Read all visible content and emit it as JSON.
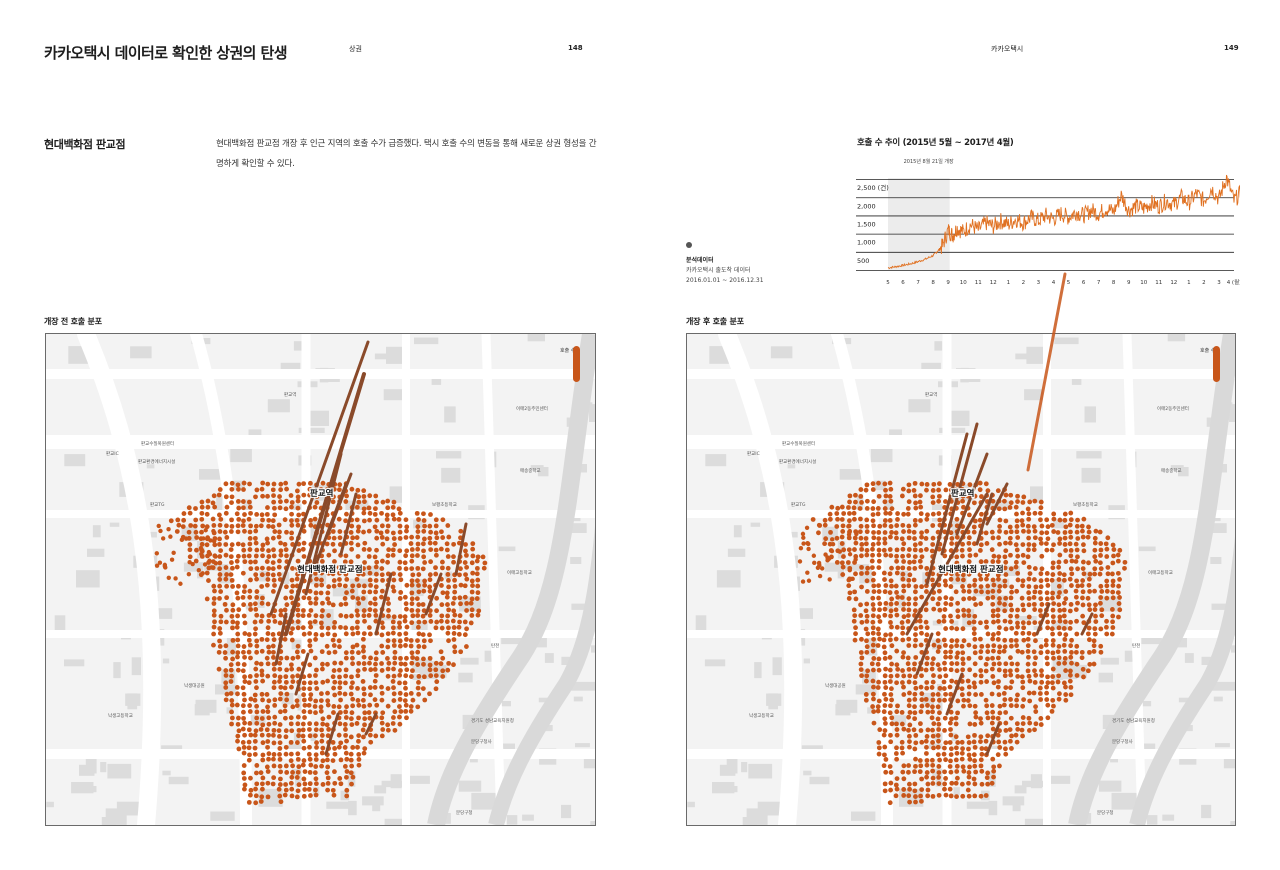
{
  "header": {
    "title": "카카오택시 데이터로 확인한 상권의 탄생",
    "left_section": "상권",
    "left_page": "148",
    "right_section": "카카오택시",
    "right_page": "149"
  },
  "section": {
    "title": "현대백화점 판교점",
    "intro": "현대백화점 판교점 개장 후 인근 지역의 호출 수가 급증했다. 택시 호출 수의 변동을 통해 새로운 상권 형성을 간명하게 확인할 수 있다."
  },
  "note": {
    "label": "분석데이터",
    "line1": "카카오택시 출도착 데이터",
    "line2": "2016.01.01 ~ 2016.12.31"
  },
  "maps": {
    "before_caption": "개장 전 호출 분포",
    "after_caption": "개장 후 호출 분포",
    "legend_label": "호출 수",
    "accent_color": "#c8561a",
    "labels": [
      {
        "text": "판교역",
        "bold": true
      },
      {
        "text": "현대백화점 판교점",
        "bold": true
      },
      {
        "text": "판교IC",
        "bold": false
      },
      {
        "text": "판교수질복원센터",
        "bold": false
      },
      {
        "text": "판교환경에너지시설",
        "bold": false
      },
      {
        "text": "판교TG",
        "bold": false
      },
      {
        "text": "판교역",
        "bold": false
      },
      {
        "text": "이매2동주민센터",
        "bold": false
      },
      {
        "text": "매송중학교",
        "bold": false
      },
      {
        "text": "보평초등학교",
        "bold": false
      },
      {
        "text": "이매고등학교",
        "bold": false
      },
      {
        "text": "탄천",
        "bold": false
      },
      {
        "text": "낙생대공원",
        "bold": false
      },
      {
        "text": "낙생고등학교",
        "bold": false
      },
      {
        "text": "경기도 성남교육지원청",
        "bold": false
      },
      {
        "text": "분당구청사",
        "bold": false
      },
      {
        "text": "분당구청",
        "bold": false
      }
    ]
  },
  "chart_data": {
    "type": "line",
    "title": "호출 수 추이 (2015년 5월 ~ 2017년 4월)",
    "annotation": "2015년 8월 21일 개장",
    "y_tick_labels": [
      "2,500 (건)",
      "2,000",
      "1,500",
      "1,000",
      "500"
    ],
    "y_ticks": [
      2500,
      2000,
      1500,
      1000,
      500
    ],
    "ylim": [
      0,
      2750
    ],
    "x_tick_labels": [
      "5",
      "6",
      "7",
      "8",
      "9",
      "10",
      "11",
      "12",
      "1",
      "2",
      "3",
      "4",
      "5",
      "6",
      "7",
      "8",
      "9",
      "10",
      "11",
      "12",
      "1",
      "2",
      "3",
      "4 (월)"
    ],
    "series": [
      {
        "color": "#e07020",
        "x_months": [
          0,
          0.5,
          1,
          1.5,
          2,
          2.5,
          3,
          3.3,
          3.6,
          4,
          4.3,
          4.6,
          5,
          5.5,
          6,
          6.5,
          7,
          7.5,
          8,
          8.5,
          9,
          9.5,
          10,
          10.5,
          11,
          11.5,
          12,
          12.5,
          13,
          13.5,
          14,
          14.5,
          15,
          15.5,
          16,
          16.5,
          17,
          17.5,
          18,
          18.5,
          19,
          19.5,
          20,
          20.5,
          21,
          21.5,
          22,
          22.5,
          23,
          23.5,
          24
        ],
        "values": [
          60,
          90,
          130,
          170,
          230,
          300,
          400,
          520,
          650,
          1100,
          950,
          1150,
          1050,
          1250,
          1100,
          1300,
          1200,
          1350,
          1250,
          1400,
          1300,
          1450,
          1350,
          1500,
          1400,
          1550,
          1450,
          1600,
          1500,
          1650,
          1550,
          1700,
          1600,
          2050,
          1650,
          1750,
          1700,
          1850,
          1750,
          1900,
          1800,
          2000,
          1850,
          2100,
          1900,
          2250,
          1950,
          2550,
          1900,
          2150,
          1750
        ]
      }
    ]
  }
}
